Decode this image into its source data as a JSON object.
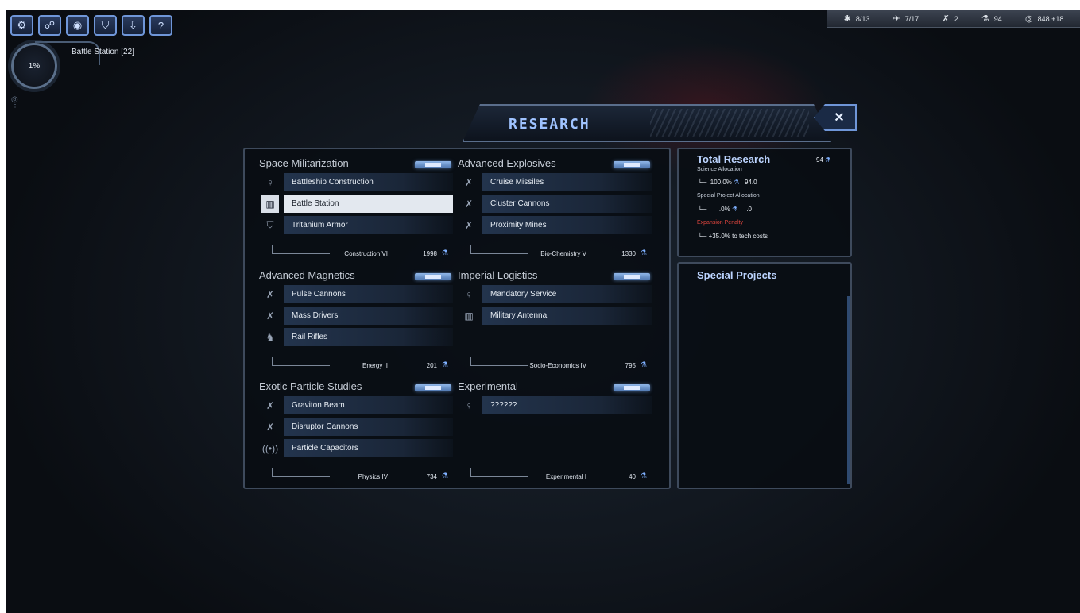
{
  "toolbar": {
    "buttons": [
      {
        "icon": "network-icon",
        "glyph": "⚙"
      },
      {
        "icon": "satellite-icon",
        "glyph": "☍"
      },
      {
        "icon": "target-icon",
        "glyph": "◉"
      },
      {
        "icon": "shield-icon",
        "glyph": "⛉"
      },
      {
        "icon": "download-icon",
        "glyph": "⇩"
      },
      {
        "icon": "help-icon",
        "glyph": "?"
      }
    ]
  },
  "production": {
    "percent": "1%",
    "label": "Battle Station [22]"
  },
  "resources": [
    {
      "icon": "planets-icon",
      "glyph": "✱",
      "value": "8/13"
    },
    {
      "icon": "fleet-icon",
      "glyph": "✈",
      "value": "7/17"
    },
    {
      "icon": "ships-icon",
      "glyph": "✗",
      "value": "2"
    },
    {
      "icon": "research-flask-icon",
      "glyph": "⚗",
      "value": "94"
    },
    {
      "icon": "credits-icon",
      "glyph": "◎",
      "value": "848 +18"
    }
  ],
  "title": "RESEARCH",
  "close_glyph": "✕",
  "categories": [
    {
      "name": "Space Militarization",
      "techs": [
        {
          "name": "Battleship Construction",
          "icon": "bulb-icon",
          "glyph": "♀",
          "selected": false
        },
        {
          "name": "Battle Station",
          "icon": "building-icon",
          "glyph": "▥",
          "selected": true
        },
        {
          "name": "Tritanium Armor",
          "icon": "shield-icon",
          "glyph": "⛉",
          "selected": false
        }
      ],
      "req": {
        "name": "Construction VI",
        "cost": "1998"
      }
    },
    {
      "name": "Advanced Explosives",
      "techs": [
        {
          "name": "Cruise Missiles",
          "icon": "weapon-icon",
          "glyph": "✗",
          "selected": false
        },
        {
          "name": "Cluster Cannons",
          "icon": "weapon-icon",
          "glyph": "✗",
          "selected": false
        },
        {
          "name": "Proximity Mines",
          "icon": "weapon-icon",
          "glyph": "✗",
          "selected": false
        }
      ],
      "req": {
        "name": "Bio-Chemistry V",
        "cost": "1330"
      }
    },
    {
      "name": "Advanced Magnetics",
      "techs": [
        {
          "name": "Pulse Cannons",
          "icon": "weapon-icon",
          "glyph": "✗",
          "selected": false
        },
        {
          "name": "Mass Drivers",
          "icon": "weapon-icon",
          "glyph": "✗",
          "selected": false
        },
        {
          "name": "Rail Rifles",
          "icon": "soldier-icon",
          "glyph": "♞",
          "selected": false
        }
      ],
      "req": {
        "name": "Energy II",
        "cost": "201"
      }
    },
    {
      "name": "Imperial Logistics",
      "techs": [
        {
          "name": "Mandatory Service",
          "icon": "bulb-icon",
          "glyph": "♀",
          "selected": false
        },
        {
          "name": "Military Antenna",
          "icon": "building-icon",
          "glyph": "▥",
          "selected": false
        }
      ],
      "req": {
        "name": "Socio-Economics IV",
        "cost": "795"
      }
    },
    {
      "name": "Exotic Particle Studies",
      "techs": [
        {
          "name": "Graviton Beam",
          "icon": "weapon-icon",
          "glyph": "✗",
          "selected": false
        },
        {
          "name": "Disruptor Cannons",
          "icon": "weapon-icon",
          "glyph": "✗",
          "selected": false
        },
        {
          "name": "Particle Capacitors",
          "icon": "signal-icon",
          "glyph": "((•))",
          "selected": false
        }
      ],
      "req": {
        "name": "Physics IV",
        "cost": "734"
      }
    },
    {
      "name": "Experimental",
      "techs": [
        {
          "name": "??????",
          "icon": "bulb-icon",
          "glyph": "♀",
          "selected": false
        }
      ],
      "req": {
        "name": "Experimental I",
        "cost": "40"
      }
    }
  ],
  "total_research": {
    "title": "Total Research",
    "total": "94",
    "science_label": "Science Allocation",
    "science_pct": "100.0%",
    "science_val": "94.0",
    "special_label": "Special Project Allocation",
    "special_pct": ".0%",
    "special_val": ".0",
    "penalty_label": "Expansion Penalty",
    "penalty_text": "+35.0% to tech costs"
  },
  "special_projects": {
    "title": "Special Projects"
  }
}
